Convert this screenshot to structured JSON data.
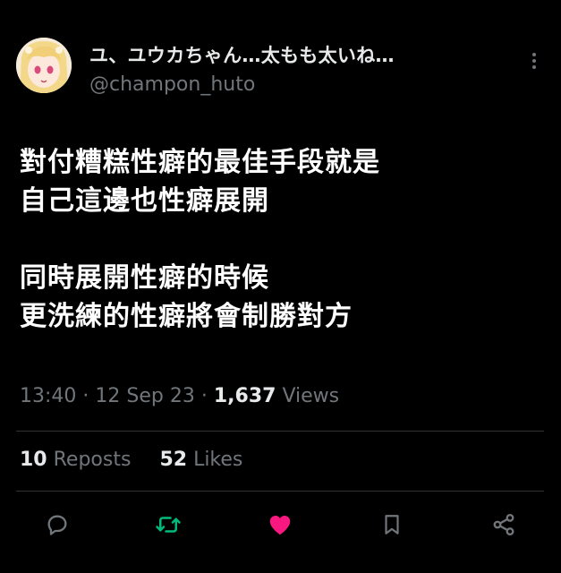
{
  "author": {
    "display_name": "ユ、ユウカちゃん…太もも太いね…",
    "handle": "@champon_huto"
  },
  "tweet": {
    "lines_a": [
      "對付糟糕性癖的最佳手段就是",
      "自己這邊也性癖展開"
    ],
    "lines_b": [
      "同時展開性癖的時候",
      "更洗練的性癖將會制勝對方"
    ]
  },
  "meta": {
    "time": "13:40",
    "date": "12 Sep 23",
    "views_count": "1,637",
    "views_label": "Views",
    "sep": "·"
  },
  "stats": {
    "reposts_count": "10",
    "reposts_label": "Reposts",
    "likes_count": "52",
    "likes_label": "Likes"
  },
  "colors": {
    "background": "#000000",
    "text": "#e7e9ea",
    "muted": "#71767b",
    "repost_green": "#00ba7c",
    "like_pink": "#f91880"
  },
  "icons": [
    "more-icon",
    "reply-icon",
    "repost-icon",
    "like-icon",
    "bookmark-icon",
    "share-icon"
  ]
}
